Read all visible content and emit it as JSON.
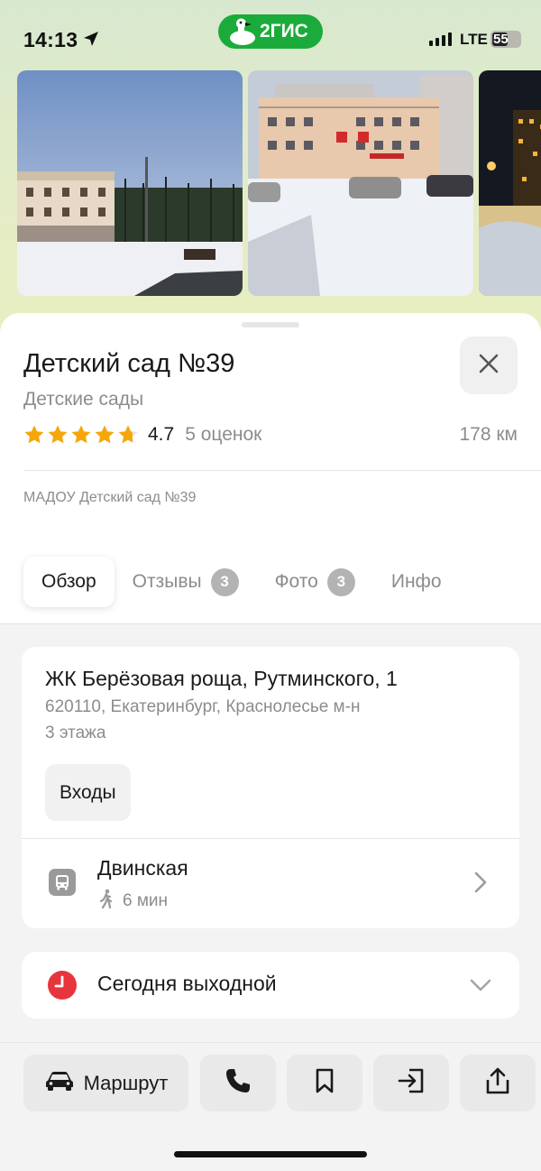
{
  "status_bar": {
    "time": "14:13",
    "brand": "2ГИС",
    "network": "LTE",
    "battery": "55",
    "battery_level": 0.55
  },
  "place": {
    "title": "Детский сад №39",
    "category": "Детские сады",
    "rating": "4.7",
    "rating_stars": 4.7,
    "rating_count": "5 оценок",
    "distance": "178 км",
    "org_name": "МАДОУ Детский сад №39"
  },
  "tabs": [
    {
      "label": "Обзор",
      "count": ""
    },
    {
      "label": "Отзывы",
      "count": "3"
    },
    {
      "label": "Фото",
      "count": "3"
    },
    {
      "label": "Инфо",
      "count": ""
    }
  ],
  "address": {
    "main": "ЖК Берёзовая роща, Рутминского, 1",
    "sub": "620110, Екатеринбург, Краснолесье м-н",
    "floors": "3 этажа",
    "entrances_label": "Входы"
  },
  "transit": {
    "stop_name": "Двинская",
    "walk_time": "6 мин"
  },
  "hours": {
    "text": "Сегодня выходной"
  },
  "actions": {
    "route_label": "Маршрут"
  },
  "colors": {
    "brand_green": "#1bab3a",
    "star_gold": "#f6a609",
    "closed_red": "#e8343c"
  },
  "icons": [
    "location-arrow-icon",
    "goose-logo-icon",
    "close-icon",
    "star-icon",
    "bus-icon",
    "walking-icon",
    "chevron-right-icon",
    "clock-icon",
    "chevron-down-icon",
    "car-icon",
    "phone-icon",
    "bookmark-icon",
    "enter-icon",
    "share-icon"
  ]
}
